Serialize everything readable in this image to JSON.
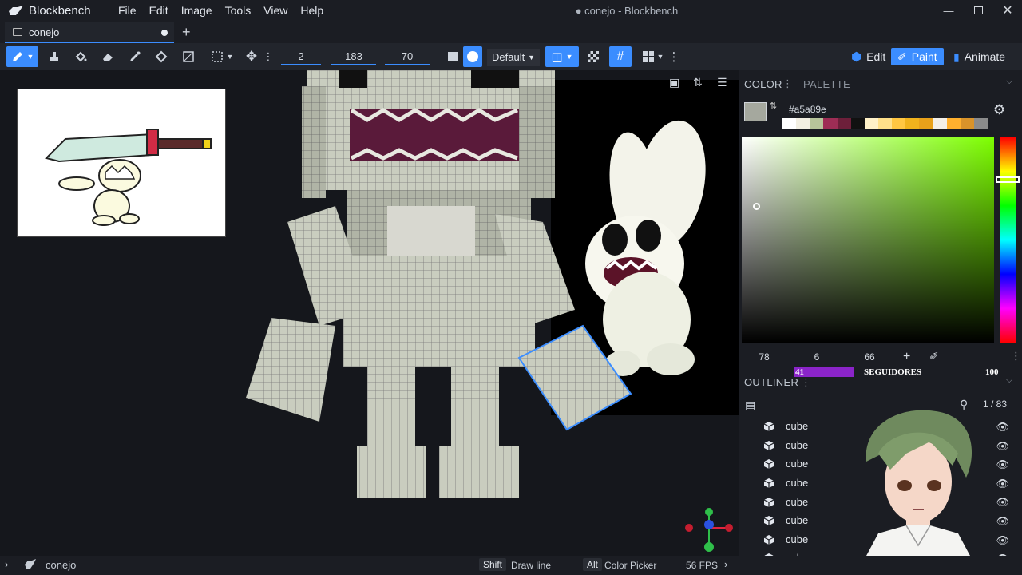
{
  "app": {
    "name": "Blockbench",
    "window_title": "● conejo - Blockbench"
  },
  "menu": [
    "File",
    "Edit",
    "Image",
    "Tools",
    "View",
    "Help"
  ],
  "tabs": [
    {
      "label": "conejo"
    }
  ],
  "toolbar": {
    "brush_size": "2",
    "opacity": "183",
    "softness": "70",
    "blend_mode": "Default"
  },
  "modes": {
    "edit": "Edit",
    "paint": "Paint",
    "animate": "Animate"
  },
  "color_panel": {
    "header": "COLOR",
    "palette_tab": "PALETTE",
    "hex": "#a5a89e",
    "values": {
      "h": "78",
      "s": "6",
      "v": "66"
    },
    "palette_colors": [
      "#ffffff",
      "#f2efe2",
      "#b7c49a",
      "#9e2d55",
      "#6d1f3a",
      "#111111",
      "#fff1c8",
      "#ffe08a",
      "#ffc642",
      "#f0b21d",
      "#e8a11a",
      "#f4f0e8",
      "#ffb02e",
      "#d9932a",
      "#8b8b8b"
    ]
  },
  "overlay": {
    "left": "41",
    "label": "SEGUIDORES",
    "right": "100",
    "fill_percent": 41
  },
  "outliner": {
    "header": "OUTLINER",
    "count": "1 / 83",
    "items": [
      "cube",
      "cube",
      "cube",
      "cube",
      "cube",
      "cube",
      "cube",
      "cube"
    ]
  },
  "statusbar": {
    "project": "conejo",
    "shift_key": "Shift",
    "shift_action": "Draw line",
    "alt_key": "Alt",
    "alt_action": "Color Picker",
    "fps": "56 FPS"
  },
  "colors": {
    "accent": "#3b8dff",
    "selected_color": "#a5a89e",
    "overlay_fill": "#8b24c9"
  }
}
